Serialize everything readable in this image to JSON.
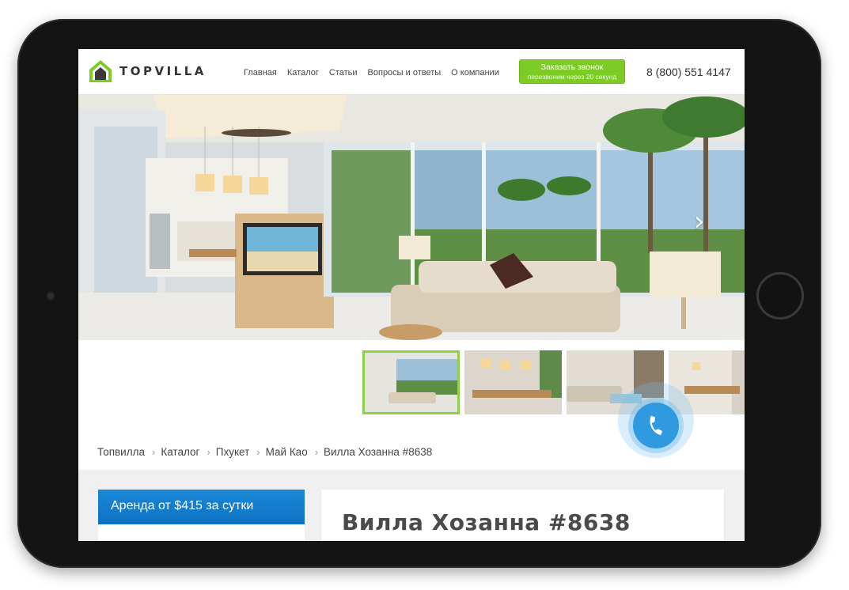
{
  "site": {
    "logo_text": "TOPVILLA",
    "nav": [
      "Главная",
      "Каталог",
      "Статьи",
      "Вопросы и ответы",
      "О компании"
    ],
    "cta": {
      "line1": "Заказать звонок",
      "line2": "перезвоним через 20 секунд"
    },
    "phone": "8 (800) 551 4147"
  },
  "hero": {
    "next_icon": "chevron-right-icon"
  },
  "thumbnails": {
    "count": 4,
    "active_index": 0
  },
  "call_widget": {
    "icon": "phone-icon"
  },
  "breadcrumb": [
    "Топвилла",
    "Каталог",
    "Пхукет",
    "Май Као",
    "Вилла Хозанна #8638"
  ],
  "price": {
    "label": "Аренда от $415 за сутки"
  },
  "villa": {
    "title": "Вилла Хозанна #8638"
  },
  "colors": {
    "accent_green": "#7ccc25",
    "accent_blue": "#1a88d8"
  }
}
